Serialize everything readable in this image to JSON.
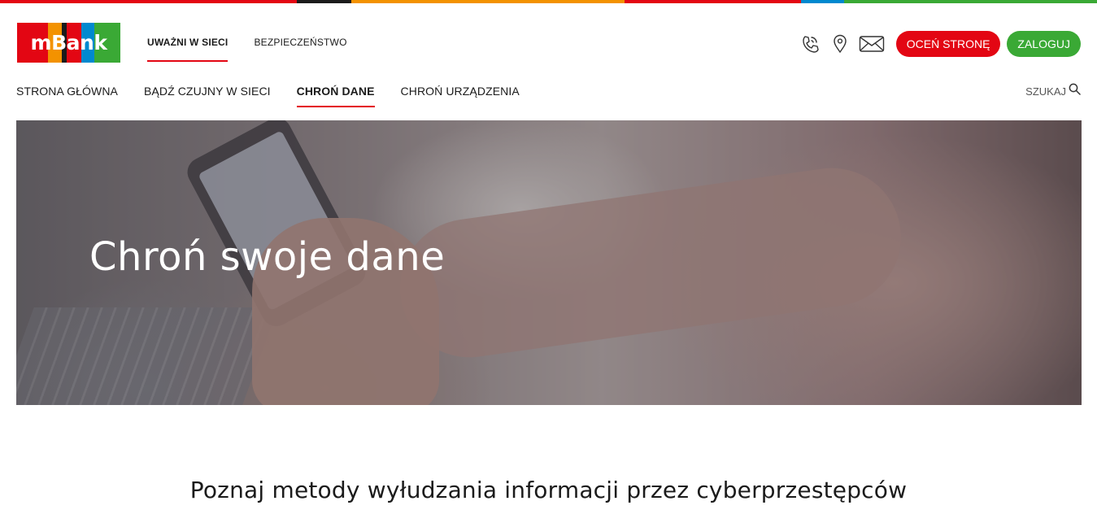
{
  "brand": {
    "logo_text": "mBank",
    "strip_colors": [
      "#e30613",
      "#1b1b1b",
      "#f39200",
      "#e30613",
      "#0089cf",
      "#3aa935"
    ],
    "logo_colors": [
      "#e30613",
      "#f39200",
      "#1b1b1b",
      "#e30613",
      "#0089cf",
      "#3aa935"
    ],
    "accent": "#e30613",
    "accent_green": "#3aa935"
  },
  "top_nav": {
    "items": [
      {
        "label": "UWAŻNI W SIECI",
        "active": true
      },
      {
        "label": "BEZPIECZEŃSTWO",
        "active": false
      }
    ]
  },
  "top_actions": {
    "icons": [
      "phone-icon",
      "location-pin-icon",
      "mail-icon"
    ],
    "rate_label": "OCEŃ STRONĘ",
    "login_label": "ZALOGUJ"
  },
  "main_nav": {
    "items": [
      {
        "label": "STRONA GŁÓWNA",
        "active": false
      },
      {
        "label": "BĄDŹ CZUJNY W SIECI",
        "active": false
      },
      {
        "label": "CHROŃ DANE",
        "active": true
      },
      {
        "label": "CHROŃ URZĄDZENIA",
        "active": false
      }
    ],
    "search_label": "SZUKAJ"
  },
  "hero": {
    "title": "Chroń swoje dane"
  },
  "section": {
    "title": "Poznaj metody wyłudzania informacji przez cyberprzestępców"
  }
}
